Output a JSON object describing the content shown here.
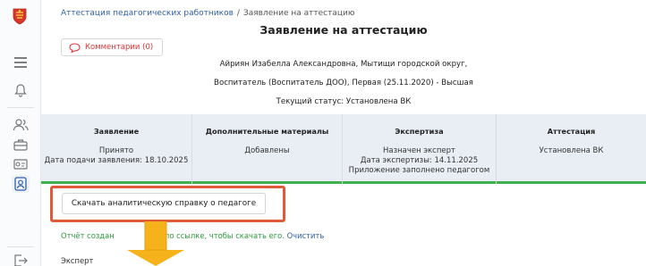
{
  "breadcrumb": {
    "root": "Аттестация педагогических работников",
    "separator": "/",
    "current": "Заявление на аттестацию"
  },
  "page_title": "Заявление на аттестацию",
  "comments_button": "Комментарии (0)",
  "applicant": {
    "line1": "Айриян Изабелла Александровна, Мытищи городской округ,",
    "line2": "Воспитатель (Воспитатель ДОО), Первая (25.11.2020) - Высшая",
    "status": "Текущий статус: Установлена ВК"
  },
  "stages": [
    {
      "title": "Заявление",
      "lines": [
        "Принято",
        "Дата подачи заявления: 18.10.2025"
      ]
    },
    {
      "title": "Дополнительные материалы",
      "lines": [
        "Добавлены"
      ]
    },
    {
      "title": "Экспертиза",
      "lines": [
        "Назначен эксперт",
        "Дата экспертизы: 14.11.2025",
        "Приложение заполнено педагогом"
      ]
    },
    {
      "title": "Аттестация",
      "lines": [
        "Установлена ВК"
      ]
    }
  ],
  "download_button": "Скачать аналитическую справку о педагоге",
  "report": {
    "prefix": "Отчёт создан",
    "middle": "ите по ссылке, чтобы скачать его.",
    "clear": "Очистить"
  },
  "expert_label": "Эксперт",
  "colors": {
    "link": "#2e5fa8",
    "accent_red": "#e05a3a",
    "success_green": "#3fb14c",
    "stage_bg": "#e9eef4",
    "arrow": "#f5b21a"
  },
  "icons": [
    "coat-of-arms-logo",
    "menu-icon",
    "bell-icon",
    "users-icon",
    "briefcase-icon",
    "certificate-icon",
    "profile-icon",
    "logout-icon",
    "comment-icon"
  ]
}
